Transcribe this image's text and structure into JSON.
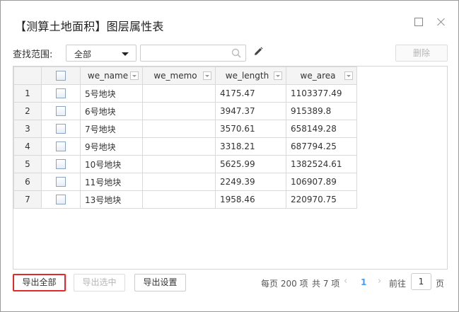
{
  "window": {
    "title": "【测算土地面积】图层属性表"
  },
  "toolbar": {
    "search_label": "查找范围:",
    "scope_value": "全部",
    "search_value": "",
    "delete_label": "删除"
  },
  "table": {
    "columns": [
      "we_name",
      "we_memo",
      "we_length",
      "we_area"
    ],
    "rows": [
      {
        "num": "1",
        "we_name": "5号地块",
        "we_memo": "",
        "we_length": "4175.47",
        "we_area": "1103377.49"
      },
      {
        "num": "2",
        "we_name": "6号地块",
        "we_memo": "",
        "we_length": "3947.37",
        "we_area": "915389.8"
      },
      {
        "num": "3",
        "we_name": "7号地块",
        "we_memo": "",
        "we_length": "3570.61",
        "we_area": "658149.28"
      },
      {
        "num": "4",
        "we_name": "9号地块",
        "we_memo": "",
        "we_length": "3318.21",
        "we_area": "687794.25"
      },
      {
        "num": "5",
        "we_name": "10号地块",
        "we_memo": "",
        "we_length": "5625.99",
        "we_area": "1382524.61"
      },
      {
        "num": "6",
        "we_name": "11号地块",
        "we_memo": "",
        "we_length": "2249.39",
        "we_area": "106907.89"
      },
      {
        "num": "7",
        "we_name": "13号地块",
        "we_memo": "",
        "we_length": "1958.46",
        "we_area": "220970.75"
      }
    ]
  },
  "footer": {
    "export_all": "导出全部",
    "export_selected": "导出选中",
    "export_settings": "导出设置"
  },
  "pagination": {
    "page_size": "每页 200 项",
    "total": "共 7 项",
    "prev": "‹",
    "current": "1",
    "next": "›",
    "goto_label": "前往",
    "goto_value": "1",
    "unit": "页"
  },
  "colors": {
    "highlight_border": "#e02b2b",
    "current_page": "#409eff"
  }
}
